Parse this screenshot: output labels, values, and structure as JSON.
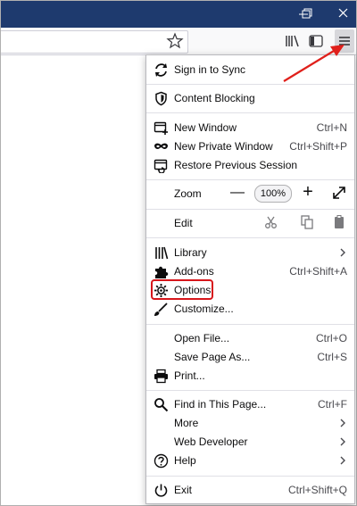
{
  "window": {
    "controls": [
      "restore-icon",
      "close-icon"
    ]
  },
  "toolbar": {
    "icons": [
      "bookmark-star-icon",
      "library-icon",
      "sidebar-icon",
      "hamburger-menu-icon"
    ]
  },
  "menu": {
    "sign_in": "Sign in to Sync",
    "content_blocking": "Content Blocking",
    "new_window": "New Window",
    "new_window_sc": "Ctrl+N",
    "new_private": "New Private Window",
    "new_private_sc": "Ctrl+Shift+P",
    "restore_session": "Restore Previous Session",
    "zoom": "Zoom",
    "zoom_minus": "—",
    "zoom_value": "100%",
    "zoom_plus": "+",
    "edit": "Edit",
    "library": "Library",
    "addons": "Add-ons",
    "addons_sc": "Ctrl+Shift+A",
    "options": "Options",
    "customize": "Customize...",
    "open_file": "Open File...",
    "open_file_sc": "Ctrl+O",
    "save_page": "Save Page As...",
    "save_page_sc": "Ctrl+S",
    "print": "Print...",
    "find": "Find in This Page...",
    "find_sc": "Ctrl+F",
    "more": "More",
    "web_developer": "Web Developer",
    "help": "Help",
    "exit": "Exit",
    "exit_sc": "Ctrl+Shift+Q"
  },
  "colors": {
    "titlebar": "#1e3a6e",
    "highlight": "#d7161b",
    "annotation_arrow": "#e0201b"
  }
}
